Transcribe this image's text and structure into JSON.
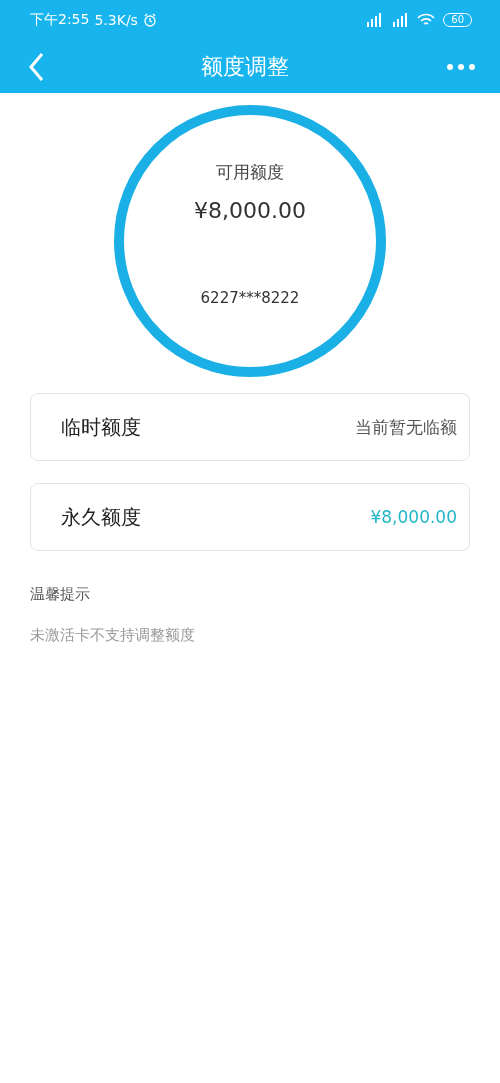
{
  "status_bar": {
    "time": "下午2:55",
    "speed": "5.3K/s",
    "battery": "60"
  },
  "nav": {
    "title": "额度调整"
  },
  "summary": {
    "label": "可用额度",
    "amount": "¥8,000.00",
    "card_number": "6227***8222"
  },
  "rows": [
    {
      "label": "临时额度",
      "value": "当前暂无临额",
      "kind": "note"
    },
    {
      "label": "永久额度",
      "value": "¥8,000.00",
      "kind": "amount"
    }
  ],
  "tips": {
    "title": "温馨提示",
    "text": "未激活卡不支持调整额度"
  }
}
